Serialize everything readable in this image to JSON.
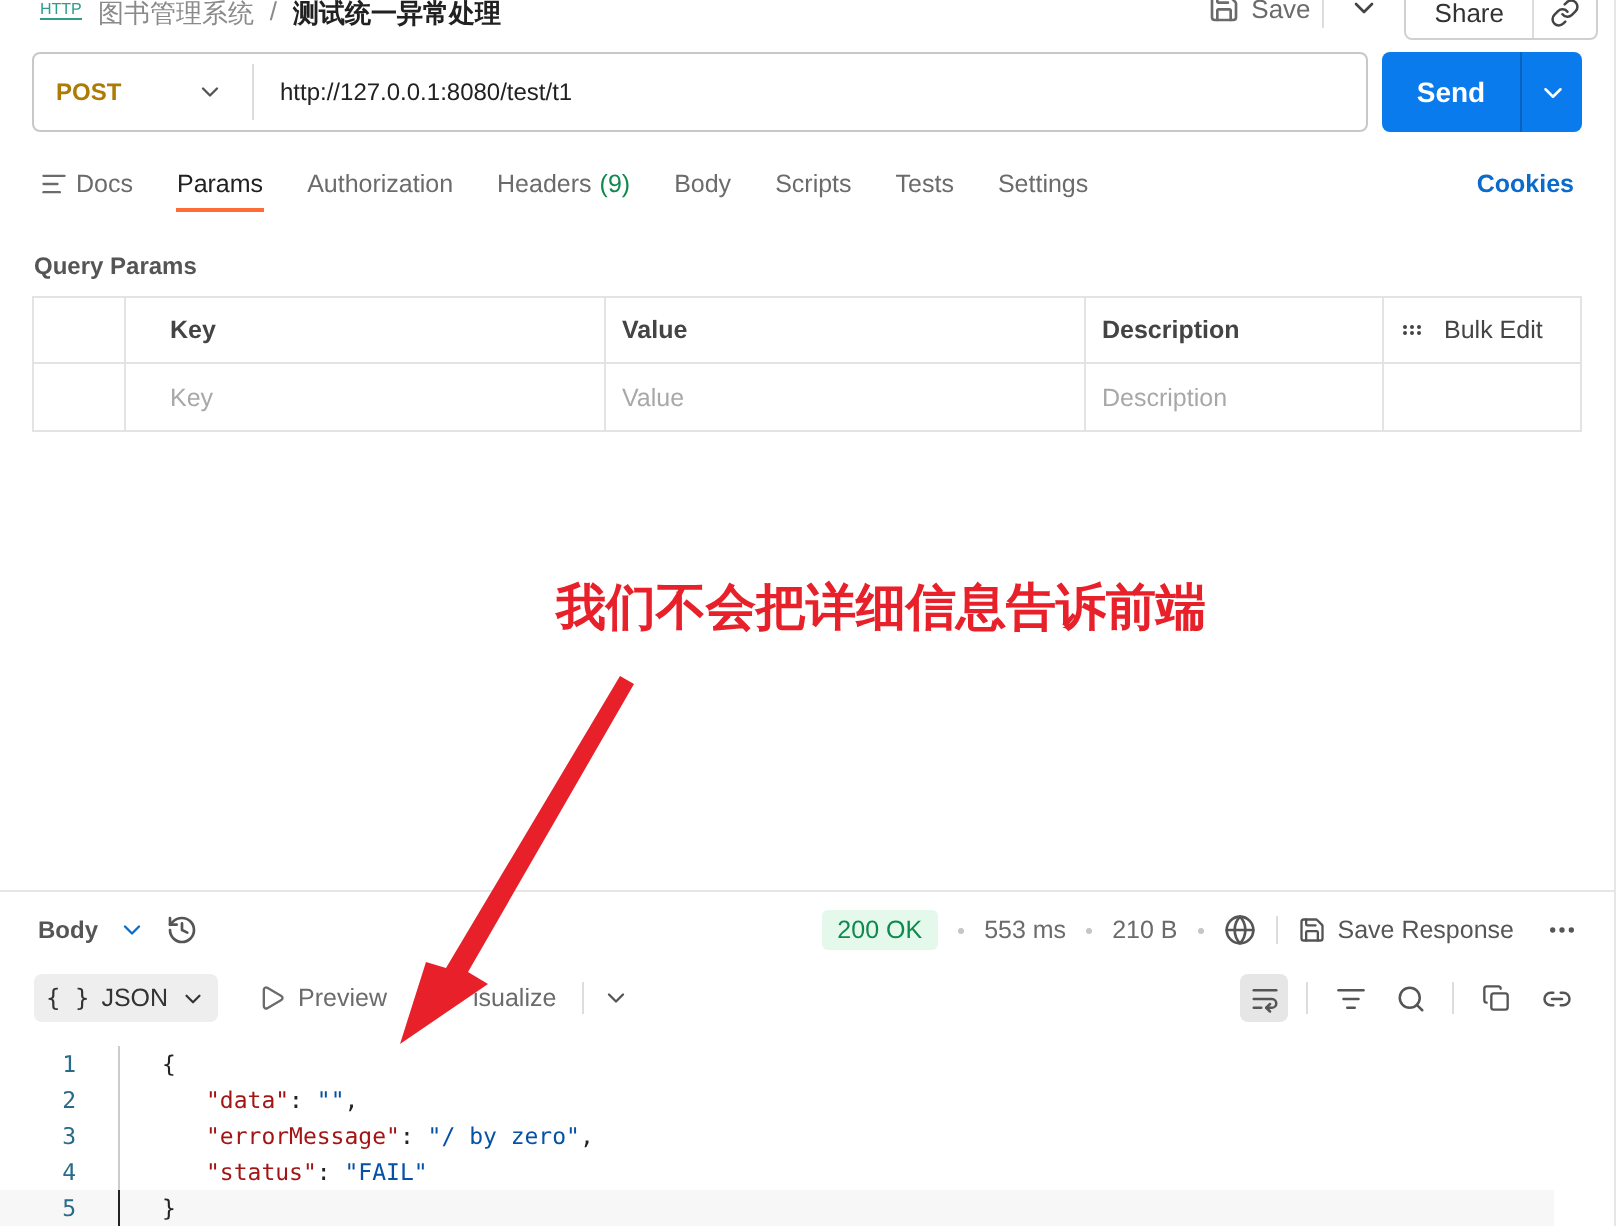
{
  "header": {
    "logo": "HTTP",
    "breadcrumb": [
      "图书管理系统",
      "测试统一异常处理"
    ],
    "separator": "/",
    "save": "Save",
    "share": "Share"
  },
  "request": {
    "method": "POST",
    "url": "http://127.0.0.1:8080/test/t1",
    "send": "Send"
  },
  "tabs": [
    {
      "label": "Docs",
      "selected": false,
      "kind": "icon"
    },
    {
      "label": "Params",
      "selected": true
    },
    {
      "label": "Authorization",
      "selected": false
    },
    {
      "label": "Headers",
      "count": "(9)",
      "selected": false
    },
    {
      "label": "Body",
      "selected": false
    },
    {
      "label": "Scripts",
      "selected": false
    },
    {
      "label": "Tests",
      "selected": false
    },
    {
      "label": "Settings",
      "selected": false
    }
  ],
  "cookies": "Cookies",
  "query_params": {
    "title": "Query Params",
    "columns": [
      "Key",
      "Value",
      "Description"
    ],
    "bulk_edit": "Bulk Edit",
    "placeholders": [
      "Key",
      "Value",
      "Description"
    ]
  },
  "annotation": {
    "text": "我们不会把详细信息告诉前端"
  },
  "response": {
    "section": "Body",
    "status": "200 OK",
    "time": "553 ms",
    "size": "210 B",
    "save_response": "Save Response",
    "format_braces": "{ }",
    "format": "JSON",
    "preview": "Preview",
    "visualize": "isualize",
    "lines": [
      {
        "number": "1",
        "tokens": [
          {
            "kind": "punct",
            "text": "{"
          }
        ]
      },
      {
        "number": "2",
        "tokens": [
          {
            "kind": "key",
            "text": "\"data\""
          },
          {
            "kind": "punct",
            "text": ": "
          },
          {
            "kind": "string",
            "text": "\"\""
          },
          {
            "kind": "punct",
            "text": ","
          }
        ]
      },
      {
        "number": "3",
        "tokens": [
          {
            "kind": "key",
            "text": "\"errorMessage\""
          },
          {
            "kind": "punct",
            "text": ": "
          },
          {
            "kind": "string",
            "text": "\"/ by zero\""
          },
          {
            "kind": "punct",
            "text": ","
          }
        ]
      },
      {
        "number": "4",
        "tokens": [
          {
            "kind": "key",
            "text": "\"status\""
          },
          {
            "kind": "punct",
            "text": ": "
          },
          {
            "kind": "string",
            "text": "\"FAIL\""
          }
        ]
      },
      {
        "number": "5",
        "tokens": [
          {
            "kind": "punct",
            "text": "}"
          }
        ],
        "current": true
      }
    ]
  }
}
